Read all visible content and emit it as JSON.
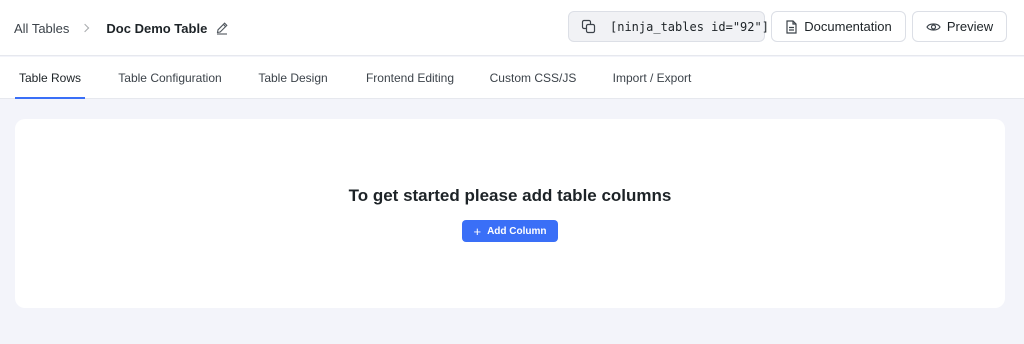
{
  "breadcrumb": {
    "root": "All Tables",
    "current": "Doc Demo Table"
  },
  "header": {
    "shortcode": "[ninja_tables id=\"92\"]",
    "documentation_label": "Documentation",
    "preview_label": "Preview"
  },
  "tabs": [
    {
      "label": "Table Rows",
      "active": true
    },
    {
      "label": "Table Configuration",
      "active": false
    },
    {
      "label": "Table Design",
      "active": false
    },
    {
      "label": "Frontend Editing",
      "active": false
    },
    {
      "label": "Custom CSS/JS",
      "active": false
    },
    {
      "label": "Import / Export",
      "active": false
    }
  ],
  "main": {
    "empty_message": "To get started please add table columns",
    "add_column_label": "Add Column"
  },
  "icons": {
    "breadcrumb_separator": "chevron-right-icon",
    "edit": "pencil-icon",
    "copy": "copy-icon",
    "documentation": "document-icon",
    "preview": "eye-icon",
    "add": "plus-icon"
  },
  "colors": {
    "accent": "#3a6ff7",
    "page_background": "#f3f4fa"
  }
}
